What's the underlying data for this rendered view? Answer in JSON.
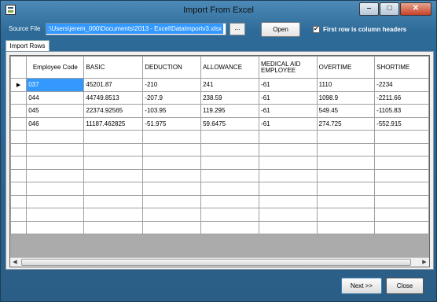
{
  "window": {
    "title": "Import From Excel"
  },
  "toolbar": {
    "source_label": "Source File",
    "source_path": ":\\Users\\jerem_000\\Documents\\2013 - Excel\\DataImportv3.xlsx",
    "browse_label": "...",
    "open_label": "Open",
    "first_row_headers_label": "First row is column headers",
    "first_row_headers_checked": true
  },
  "tab": {
    "label": "Import Rows"
  },
  "grid": {
    "columns": [
      "Employee Code",
      "BASIC",
      "DEDUCTION",
      "ALLOWANCE",
      "MEDICAL AID EMPLOYEE",
      "OVERTIME",
      "SHORTIME"
    ],
    "rows": [
      [
        "037",
        "45201.87",
        "-210",
        "241",
        "-61",
        "1110",
        "-2234"
      ],
      [
        "044",
        "44749.8513",
        "-207.9",
        "238.59",
        "-61",
        "1098.9",
        "-2211.66"
      ],
      [
        "045",
        "22374.92565",
        "-103.95",
        "119.295",
        "-61",
        "549.45",
        "-1105.83"
      ],
      [
        "046",
        "11187.462825",
        "-51.975",
        "59.6475",
        "-61",
        "274.725",
        "-552.915"
      ]
    ]
  },
  "footer": {
    "next_label": "Next >>",
    "close_label": "Close"
  }
}
